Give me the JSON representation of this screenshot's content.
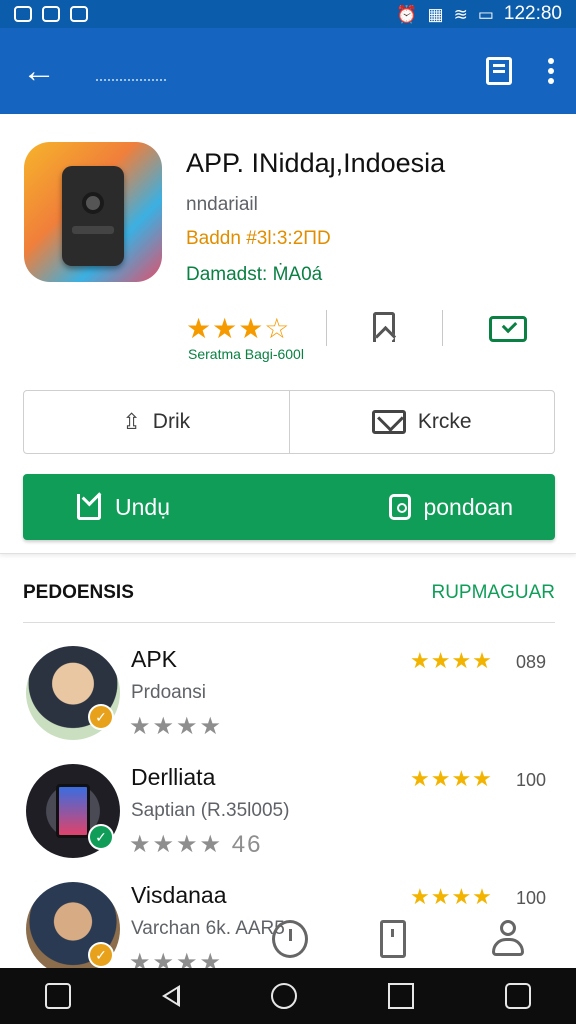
{
  "status_bar": {
    "time": "122:80",
    "wifi_glyph": "≋",
    "battery_glyph": "▭"
  },
  "app_bar": {
    "back_glyph": "←"
  },
  "app": {
    "title": "APP. INiddaȷ,Indoesia",
    "subtitle": "nndariail",
    "meta_orange": "Baddn #3l:3:2ΠD",
    "meta_green": "Damadst: ṀA0á",
    "stars": "★★★☆",
    "rating_caption": "Seratma Bagi-600l",
    "share_label": "Drik",
    "share_glyph": "⇫",
    "message_label": "Krcke",
    "install_label": "Undụ",
    "secondary_label": "pondoan"
  },
  "similar": {
    "title": "PEDOENSIS",
    "link": "RUPMAGUAR",
    "items": [
      {
        "title": "APK",
        "subtitle": "Prdoansi",
        "stars": "★★★★",
        "rating": "★★★★",
        "count": "089",
        "badge": "✓",
        "badge_color": "#e7a11b"
      },
      {
        "title": "Derlliata",
        "subtitle": "Saptian (R.35l005)",
        "stars": "★★★★ 46",
        "rating": "★★★★",
        "count": "100",
        "badge": "✓",
        "badge_color": "#0f9d58"
      },
      {
        "title": "Visdanaa",
        "subtitle": "Varchan 6k. AAR5",
        "stars": "★★★★",
        "rating": "★★★★",
        "count": "100",
        "badge": "✓",
        "badge_color": "#e7a11b"
      }
    ]
  },
  "colors": {
    "app_bar": "#1565c0",
    "status_bar": "#0b5cab",
    "install_green": "#0f9d58",
    "star_gold": "#f2b400"
  },
  "icons": [
    "back-arrow-icon",
    "bookmark-icon",
    "more-vert-icon",
    "share-icon",
    "mail-icon",
    "download-icon",
    "clock-icon",
    "timer-icon",
    "document-icon",
    "user-icon"
  ]
}
